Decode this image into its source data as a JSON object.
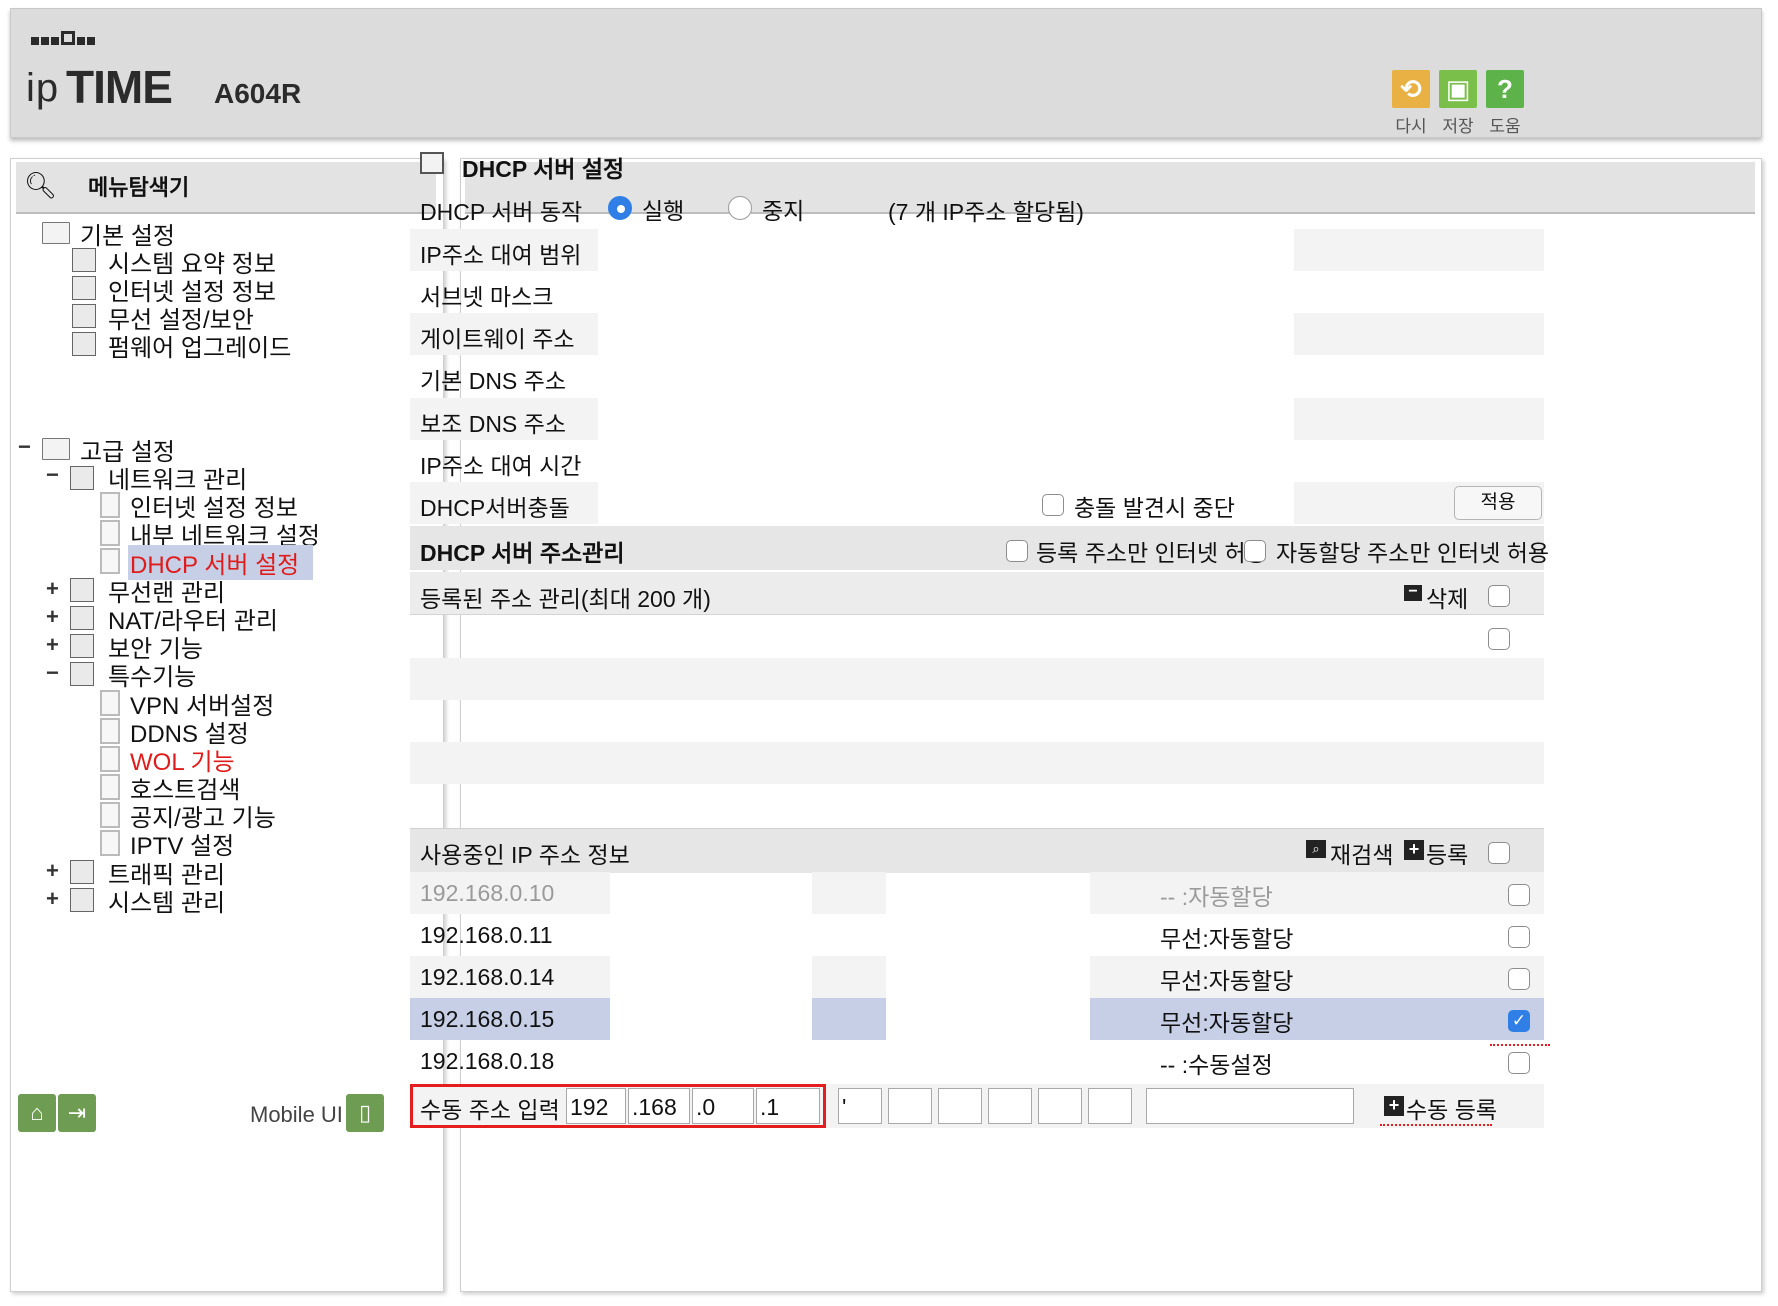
{
  "header": {
    "brand": "ipTIME",
    "brand_prefix": "ip",
    "brand_main": "TIME",
    "model": "A604R",
    "actions": [
      {
        "label": "다시",
        "icon": "reset-icon",
        "color": "#e9b144"
      },
      {
        "label": "저장",
        "icon": "save-icon",
        "color": "#7bbf4b"
      },
      {
        "label": "도움",
        "icon": "help-icon",
        "color": "#5db34a"
      }
    ]
  },
  "sidebar": {
    "title": "메뉴탐색기",
    "basic": {
      "label": "기본 설정",
      "items": [
        "시스템 요약 정보",
        "인터넷 설정 정보",
        "무선 설정/보안",
        "펌웨어 업그레이드"
      ]
    },
    "advanced": {
      "label": "고급 설정",
      "network": {
        "label": "네트워크 관리",
        "items": [
          "인터넷 설정 정보",
          "내부 네트워크 설정",
          "DHCP 서버 설정"
        ],
        "active": "DHCP 서버 설정"
      },
      "wireless": "무선랜 관리",
      "nat": "NAT/라우터 관리",
      "security": "보안 기능",
      "special": {
        "label": "특수기능",
        "items": [
          "VPN 서버설정",
          "DDNS 설정",
          "WOL 기능",
          "호스트검색",
          "공지/광고 기능",
          "IPTV 설정"
        ]
      },
      "traffic": "트래픽 관리",
      "system": "시스템 관리"
    },
    "footer": {
      "mobile_label": "Mobile UI"
    }
  },
  "main": {
    "title": "DHCP 서버 설정",
    "server_action": {
      "label": "DHCP 서버 동작",
      "options": [
        "실행",
        "중지"
      ],
      "selected": "실행",
      "note": "(7 개 IP주소 할당됨)"
    },
    "fields": [
      "IP주소 대여 범위",
      "서브넷 마스크",
      "게이트웨이 주소",
      "기본 DNS 주소",
      "보조 DNS 주소",
      "IP주소 대여 시간"
    ],
    "conflict": {
      "label": "DHCP서버충돌",
      "checkbox_label": "충돌 발견시 중단",
      "apply_label": "적용"
    },
    "addr_mgmt": {
      "title": "DHCP 서버 주소관리",
      "opt_registered": "등록 주소만 인터넷 허용",
      "opt_auto": "자동할당 주소만 인터넷 허용"
    },
    "registered": {
      "title": "등록된 주소 관리(최대 200 개)",
      "delete_label": "삭제"
    },
    "in_use": {
      "title": "사용중인 IP 주소 정보",
      "rescan_label": "재검색",
      "register_label": "등록",
      "rows": [
        {
          "ip": "192.168.0.10",
          "type": "-- :자동할당",
          "checked": false
        },
        {
          "ip": "192.168.0.11",
          "type": "무선:자동할당",
          "checked": false
        },
        {
          "ip": "192.168.0.14",
          "type": "무선:자동할당",
          "checked": false
        },
        {
          "ip": "192.168.0.15",
          "type": "무선:자동할당",
          "checked": true
        },
        {
          "ip": "192.168.0.18",
          "type": "-- :수동설정",
          "checked": false
        }
      ]
    },
    "manual": {
      "label": "수동 주소 입력",
      "ip": [
        "192",
        ".168",
        ".0",
        ".1"
      ],
      "mac_first": "'",
      "register_label": "수동 등록"
    }
  },
  "colors": {
    "accent": "#e01b1b",
    "selection": "#c6cfe6",
    "radio_on": "#2f7fe6",
    "highlight_box": "#e41e1e"
  }
}
